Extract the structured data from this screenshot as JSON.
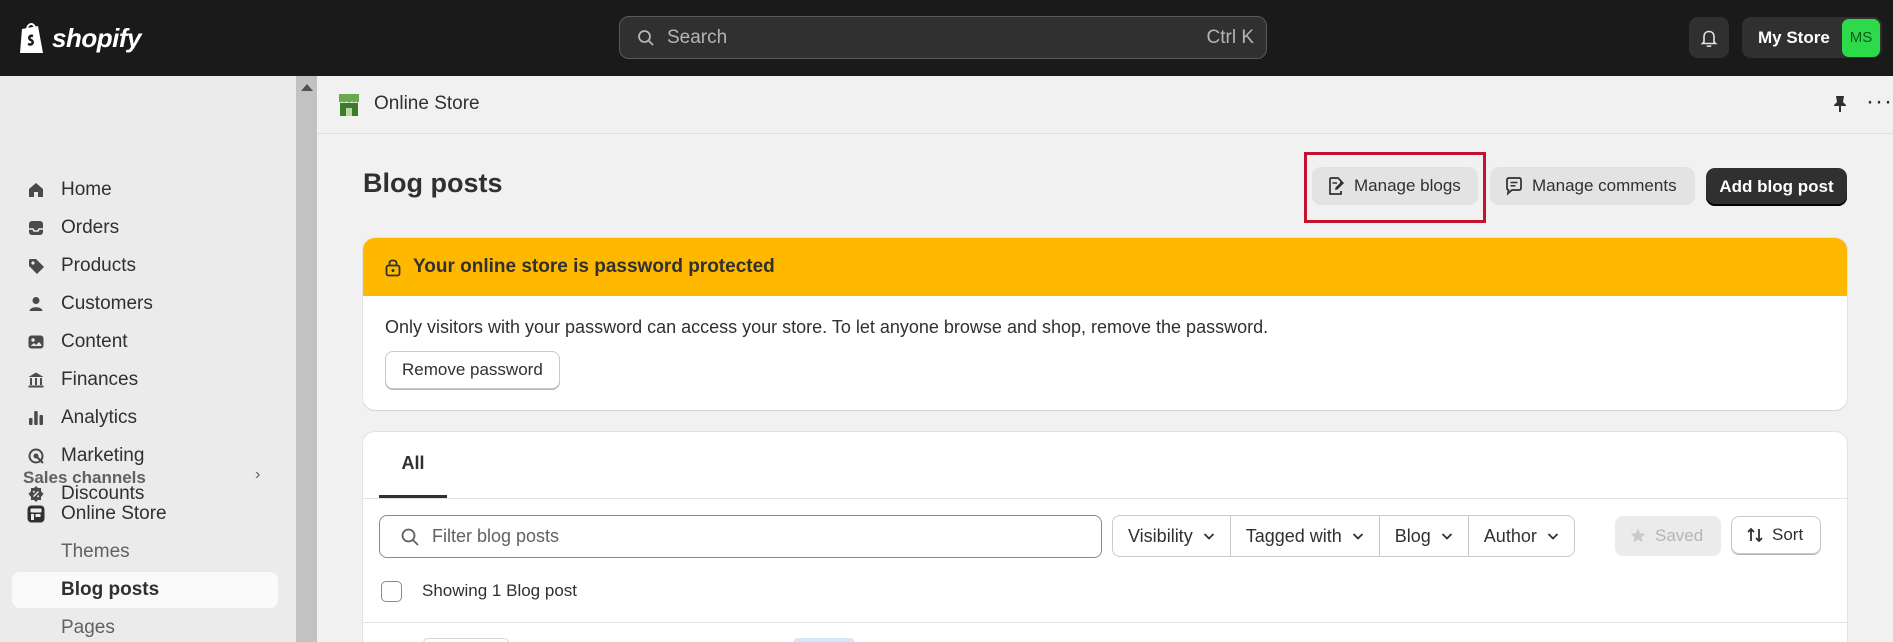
{
  "topbar": {
    "logo_text": "shopify",
    "search_placeholder": "Search",
    "search_shortcut": "Ctrl K",
    "store_name": "My Store",
    "avatar_initials": "MS",
    "avatar_color": "#2ddb4a"
  },
  "sidebar": {
    "items": [
      {
        "label": "Home",
        "icon": "home-icon"
      },
      {
        "label": "Orders",
        "icon": "inbox-icon"
      },
      {
        "label": "Products",
        "icon": "tag-icon"
      },
      {
        "label": "Customers",
        "icon": "person-icon"
      },
      {
        "label": "Content",
        "icon": "image-icon"
      },
      {
        "label": "Finances",
        "icon": "bank-icon"
      },
      {
        "label": "Analytics",
        "icon": "bar-chart-icon"
      },
      {
        "label": "Marketing",
        "icon": "target-icon"
      },
      {
        "label": "Discounts",
        "icon": "discount-icon"
      }
    ],
    "sales_channels_title": "Sales channels",
    "online_store": "Online Store",
    "sub_items": [
      "Themes",
      "Blog posts",
      "Pages"
    ]
  },
  "header": {
    "section_title": "Online Store"
  },
  "page": {
    "title": "Blog posts",
    "manage_blogs": "Manage blogs",
    "manage_comments": "Manage comments",
    "add_blog_post": "Add blog post"
  },
  "banner": {
    "title": "Your online store is password protected",
    "text": "Only visitors with your password can access your store. To let anyone browse and shop, remove the password.",
    "button": "Remove password",
    "color": "#ffb800"
  },
  "list": {
    "tab_all": "All",
    "filter_placeholder": "Filter blog posts",
    "filters": [
      "Visibility",
      "Tagged with",
      "Blog",
      "Author"
    ],
    "saved": "Saved",
    "sort": "Sort",
    "showing": "Showing 1 Blog post"
  }
}
